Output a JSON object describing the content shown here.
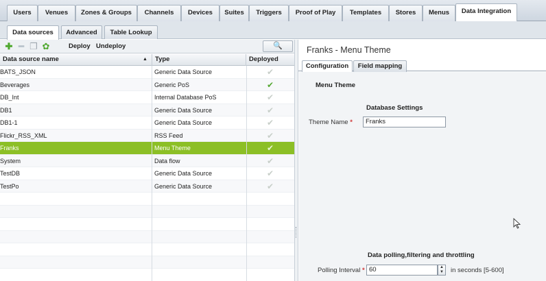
{
  "top_tabs": [
    "Users",
    "Venues",
    "Zones & Groups",
    "Channels",
    "Devices",
    "Suites",
    "Triggers",
    "Proof of Play",
    "Templates",
    "Stores",
    "Menus",
    "Data Integration"
  ],
  "sub_tabs": [
    "Data sources",
    "Advanced",
    "Table Lookup"
  ],
  "toolbar": {
    "deploy_label": "Deploy",
    "undeploy_label": "Undeploy",
    "search_glyph": "🔍"
  },
  "grid": {
    "headers": {
      "name": "Data source name",
      "sort_glyph": "▲",
      "type": "Type",
      "deployed": "Deployed"
    },
    "rows": [
      {
        "name": "BATS_JSON",
        "type": "Generic Data Source",
        "deployed": "✔"
      },
      {
        "name": "Beverages",
        "type": "Generic PoS",
        "deployed": "✔"
      },
      {
        "name": "DB_Int",
        "type": "Internal Database PoS",
        "deployed": "✔"
      },
      {
        "name": "DB1",
        "type": "Generic Data Source",
        "deployed": "✔"
      },
      {
        "name": "DB1-1",
        "type": "Generic Data Source",
        "deployed": "✔"
      },
      {
        "name": "Flickr_RSS_XML",
        "type": "RSS Feed",
        "deployed": "✔"
      },
      {
        "name": "Franks",
        "type": "Menu Theme",
        "deployed": "✔"
      },
      {
        "name": "System",
        "type": "Data flow",
        "deployed": "✔"
      },
      {
        "name": "TestDB",
        "type": "Generic Data Source",
        "deployed": "✔"
      },
      {
        "name": "TestPo",
        "type": "Generic Data Source",
        "deployed": "✔"
      }
    ]
  },
  "detail": {
    "title": "Franks - Menu Theme",
    "tabs": [
      "Configuration",
      "Field mapping"
    ],
    "section_label": "Menu Theme",
    "db_settings_heading": "Database Settings",
    "theme_name_label": "Theme Name",
    "required_mark": "*",
    "theme_name_value": "Franks",
    "polling_heading": "Data polling,filtering and throttling",
    "polling_label": "Polling Interval",
    "polling_value": "60",
    "polling_hint": "in seconds [5-600]"
  },
  "colors": {
    "selection": "#8cbf26",
    "deployed_check": "#56a833",
    "required": "#d03c3c"
  }
}
